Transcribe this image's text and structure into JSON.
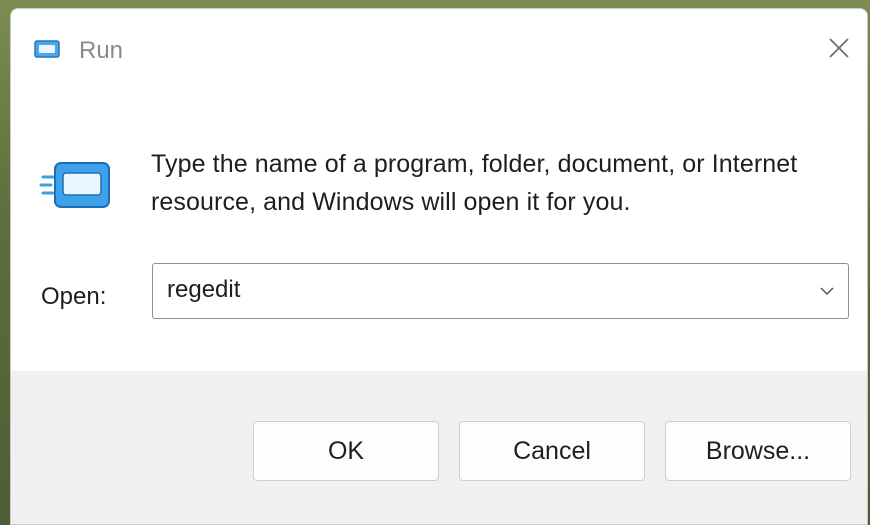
{
  "window": {
    "title": "Run",
    "title_icon": "run-icon",
    "close_icon": "close-icon"
  },
  "content": {
    "icon": "run-icon",
    "description": "Type the name of a program, folder, document, or Internet resource, and Windows will open it for you.",
    "open_label": "Open:",
    "open_value": "regedit",
    "dropdown_icon": "chevron-down-icon"
  },
  "buttons": {
    "ok": "OK",
    "cancel": "Cancel",
    "browse": "Browse..."
  },
  "colors": {
    "accent": "#2b8fd6",
    "footer_bg": "#f0f0f0"
  }
}
